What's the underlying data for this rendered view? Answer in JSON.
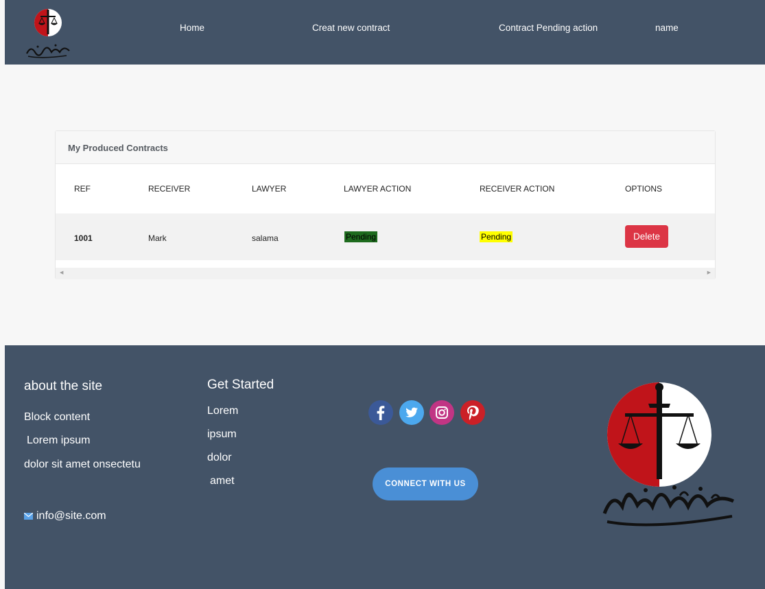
{
  "nav": {
    "home": "Home",
    "create": "Creat new contract",
    "pending": "Contract Pending action",
    "name": "name"
  },
  "card": {
    "title": "My Produced Contracts",
    "columns": [
      "REF",
      "RECEIVER",
      "LAWYER",
      "LAWYER ACTION",
      "RECEIVER ACTION",
      "OPTIONS"
    ],
    "rows": [
      {
        "ref": "1001",
        "receiver": "Mark",
        "lawyer": "salama",
        "lawyer_action": "Pending",
        "receiver_action": "Pending",
        "option_label": "Delete"
      }
    ]
  },
  "footer": {
    "about": {
      "heading": "about the site",
      "lines": [
        "Block content",
        "Lorem ipsum",
        "dolor sit amet onsectetu"
      ],
      "email": "info@site.com"
    },
    "get_started": {
      "heading": "Get Started",
      "links": [
        "Lorem",
        "ipsum",
        "dolor",
        "amet"
      ]
    },
    "social_icons": [
      "facebook-icon",
      "twitter-icon",
      "instagram-icon",
      "pinterest-icon"
    ],
    "connect_label": "CONNECT WITH US"
  },
  "colors": {
    "header_bg": "#435367",
    "page_bg": "#f7f7f7",
    "delete_button": "#dc3545",
    "connect_button": "#4a8fd6",
    "lawyer_badge": "#1e6b1e",
    "receiver_badge": "#ffff00"
  }
}
